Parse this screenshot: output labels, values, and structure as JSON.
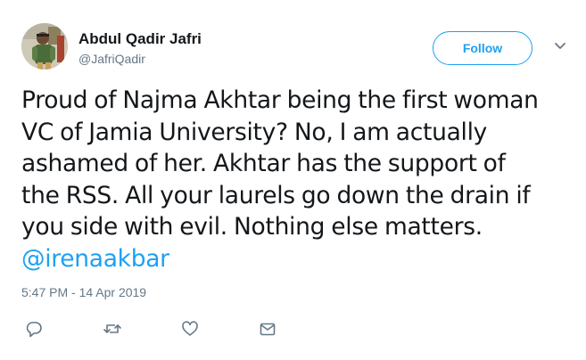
{
  "author": {
    "display_name": "Abdul Qadir Jafri",
    "handle": "@JafriQadir"
  },
  "follow_button": {
    "label": "Follow"
  },
  "tweet": {
    "lines": [
      "Proud of Najma Akhtar being the first woman",
      "VC of Jamia University? No, I am actually",
      "ashamed of her. Akhtar has the support of",
      "the RSS. All your laurels go down the drain if",
      "you side with evil. Nothing else matters."
    ],
    "mention": "@irenaakbar",
    "timestamp": "5:47 PM - 14 Apr 2019"
  },
  "actions": [
    {
      "name": "reply-icon"
    },
    {
      "name": "retweet-icon"
    },
    {
      "name": "like-icon"
    },
    {
      "name": "direct-message-icon"
    }
  ],
  "colors": {
    "accent": "#1da1f2",
    "text": "#14171a",
    "muted": "#657786"
  }
}
